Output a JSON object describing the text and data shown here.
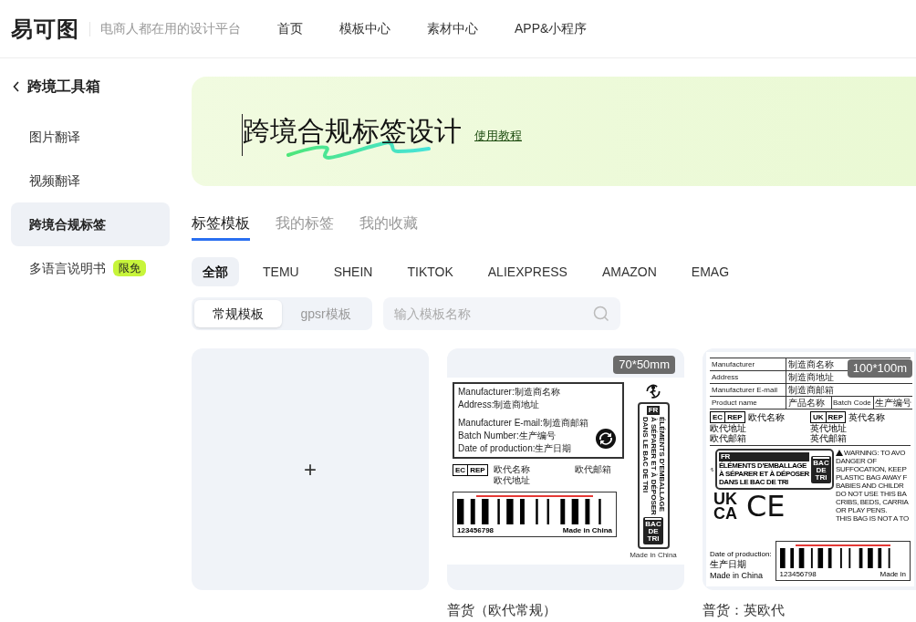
{
  "header": {
    "logo": "易可图",
    "tagline": "电商人都在用的设计平台",
    "nav": [
      "首页",
      "模板中心",
      "素材中心",
      "APP&小程序"
    ]
  },
  "sidebar": {
    "back": "跨境工具箱",
    "items": [
      {
        "label": "图片翻译",
        "selected": false
      },
      {
        "label": "视频翻译",
        "selected": false
      },
      {
        "label": "跨境合规标签",
        "selected": true
      },
      {
        "label": "多语言说明书",
        "selected": false,
        "badge": "限免"
      }
    ]
  },
  "banner": {
    "title": "跨境合规标签设计",
    "link": "使用教程"
  },
  "tabs": [
    {
      "label": "标签模板",
      "selected": true
    },
    {
      "label": "我的标签",
      "selected": false
    },
    {
      "label": "我的收藏",
      "selected": false
    }
  ],
  "platforms": [
    {
      "label": "全部",
      "selected": true
    },
    {
      "label": "TEMU",
      "selected": false
    },
    {
      "label": "SHEIN",
      "selected": false
    },
    {
      "label": "TIKTOK",
      "selected": false
    },
    {
      "label": "ALIEXPRESS",
      "selected": false
    },
    {
      "label": "AMAZON",
      "selected": false
    },
    {
      "label": "EMAG",
      "selected": false
    }
  ],
  "segments": [
    {
      "label": "常规模板",
      "selected": true
    },
    {
      "label": "gpsr模板",
      "selected": false
    }
  ],
  "search": {
    "placeholder": "输入模板名称"
  },
  "cards": [
    {
      "kind": "new",
      "symbol": "+"
    },
    {
      "kind": "label_small",
      "size": "70*50mm",
      "title": "普货（欧代常规）",
      "lines": [
        "Manufacturer:制造商名称",
        "Address:制造商地址",
        "Manufacturer E-mail:制造商邮箱",
        "Batch Number:生产编号",
        "Date of production:生产日期"
      ],
      "rep": [
        "EC",
        "REP"
      ],
      "rep_lines": [
        "欧代名称",
        "欧代地址",
        "欧代邮箱"
      ],
      "barcode_number": "123456798",
      "barcode_origin": "Made in China",
      "fr": "FR",
      "triman": [
        "ÉLÉMENTS D'EMBALLAGE",
        "À SÉPARER ET À DÉPOSER",
        "DANS LE BAC DE TRI"
      ],
      "bin": "BAC DE TRI",
      "origin": "Made in China"
    },
    {
      "kind": "label_large",
      "size": "100*100m",
      "title": "普货：英欧代",
      "table": [
        [
          "Manufacturer",
          "制造商名称"
        ],
        [
          "Address",
          "制造商地址"
        ],
        [
          "Manufacturer E-mail",
          "制造商邮箱"
        ],
        [
          "Product name",
          "产品名称",
          "Batch Code",
          "生产编号"
        ]
      ],
      "eu_rep": [
        "EC",
        "REP"
      ],
      "eu_lines": [
        "欧代名称",
        "欧代地址",
        "欧代邮箱"
      ],
      "uk_rep": [
        "UK",
        "REP"
      ],
      "uk_lines": [
        "英代名称",
        "英代地址",
        "英代邮箱"
      ],
      "fr": "FR",
      "triman": [
        "ÉLÉMENTS D'EMBALLAGE",
        "À SÉPARER ET À DÉPOSER",
        "DANS LE BAC DE TRI"
      ],
      "bin": "BAC DE TRI",
      "ukca": [
        "UK",
        "CA"
      ],
      "ce": "CE",
      "warning": [
        "WARNING: TO AVO",
        "DANGER OF",
        "SUFFOCATION, KEEP",
        "PLASTIC BAG AWAY F",
        "BABIES AND CHILDR",
        "DO NOT USE THIS BA",
        "CRIBS, BEDS, CARRIA",
        "OR PLAY PENS.",
        "THIS BAG IS NOT A TO"
      ],
      "date_label": "Date of production:",
      "date_value": "生产日期",
      "origin": "Made in China",
      "barcode_number": "123456798",
      "barcode_origin": "Made in"
    }
  ]
}
